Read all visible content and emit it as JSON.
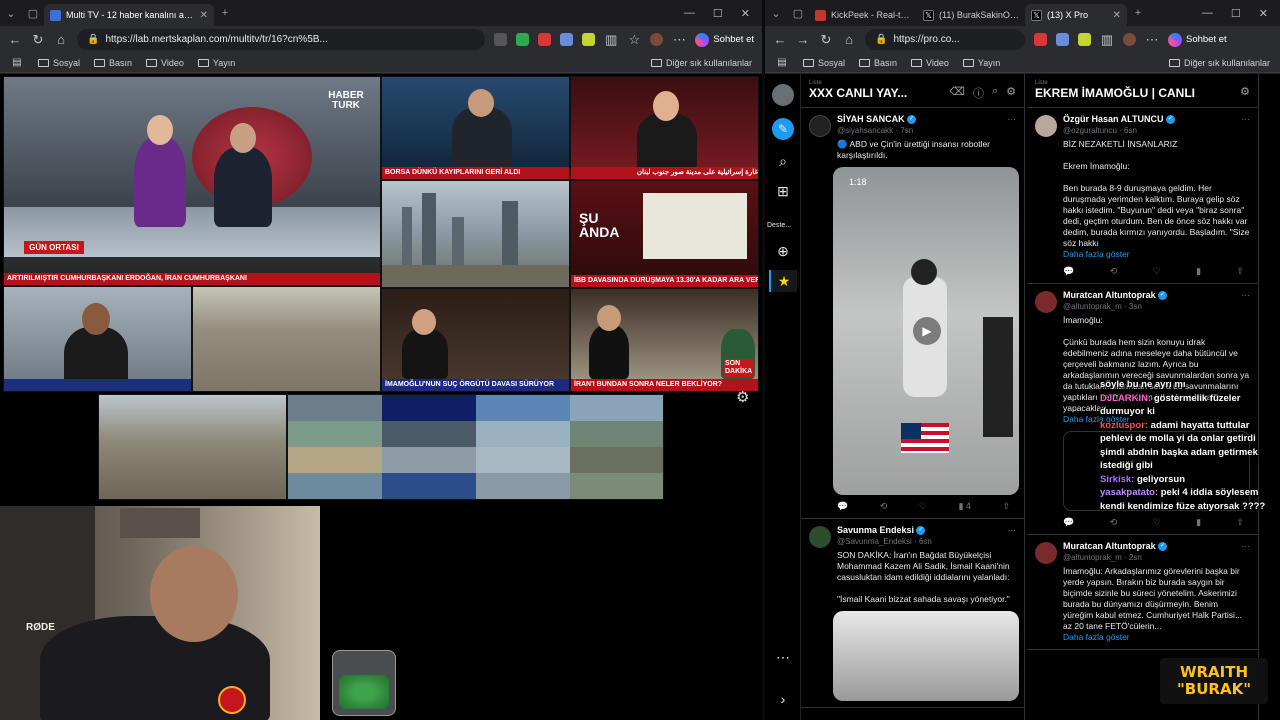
{
  "left_window": {
    "tabs": [
      {
        "title": "Multi TV - 12 haber kanalını aynı a..."
      }
    ],
    "url": "https://lab.mertskaplan.com/multitv/tr/16?cn%5B...",
    "chat_label": "Sohbet et",
    "bookmarks": [
      "Sosyal",
      "Basın",
      "Video",
      "Yayın"
    ],
    "bookmarks_right": "Diğer sık kullanılanlar"
  },
  "right_window": {
    "tabs": [
      {
        "title": "KickPeek - Real-tim..."
      },
      {
        "title": "(11) BurakSakinOl ..."
      },
      {
        "title": "(13) X Pro"
      }
    ],
    "url": "https://pro.co...",
    "chat_label": "Sohbet et",
    "bookmarks": [
      "Sosyal",
      "Basın",
      "Video",
      "Yayın"
    ],
    "bookmarks_right": "Diğer sık kullanılanlar"
  },
  "tv": {
    "t1_logo": "HABER TURK",
    "t1_badge": "GÜN ORTASI",
    "t1_ticker": "ARTIRILMIŞTIR     CUMHURBAŞKANI ERDOĞAN, İRAN CUMHURBAŞKANI",
    "t2_ticker": "BORSA DÜNKÜ KAYIPLARINI GERİ ALDI",
    "t3_ticker": "غارة إسرائيلية على مدينة صور جنوب لبنان",
    "t5_badge": "ŞU ANDA",
    "t5_ticker": "İBB DAVASINDA DURUŞMAYA 13.30'A KADAR ARA VERİLDİ",
    "t7_ticker": "İMAMOĞLU'NUN SUÇ ÖRGÜTÜ DAVASI SÜRÜYOR",
    "t8_ticker": "İRAN'I BUNDAN SONRA NELER BEKLİYOR?",
    "t8_badge": "SON DAKİKA",
    "mic_label": "RØDE"
  },
  "x_pro": {
    "col1_label": "Liste",
    "col1_title": "XXX CANLI YAY...",
    "col2_label": "Liste",
    "col2_title": "EKREM İMAMOĞLU | CANLI",
    "rail_deck": "Deste...",
    "col1_tweets": [
      {
        "name": "SİYAH SANCAK",
        "handle": "@siyahsancakk · 7sn",
        "body": "🔵 ABD ve Çin'in ürettiği insansı robotler karşılaştırıldı.",
        "media_label": "1:18",
        "likes": "4"
      },
      {
        "name": "Savunma Endeksi",
        "handle": "@Savunma_Endeksi · 6sn",
        "body": "SON DAKİKA: İran'ın Bağdat Büyükelçisi Mohammad Kazem Ali Sadik, İsmail Kaani'nin casusluktan idam edildiği iddialarını yalanladı:\n\n\"İsmail Kaani bizzat sahada savaşı yönetiyor.\""
      }
    ],
    "col2_tweets": [
      {
        "name": "Özgür Hasan ALTUNCU",
        "handle": "@ozguraltuncu · 6sn",
        "body": "BİZ NEZAKETLİ İNSANLARIZ\n\nEkrem İmamoğlu:\n\nBen burada 8-9 duruşmaya geldim. Her duruşmada yerimden kalktım. Buraya gelip söz hakkı istedim. \"Buyurun\" dedi veya \"biraz sonra\" dedi, geçtim oturdum. Ben de önce söz hakkı var dedim, burada kırmızı yanıyordu. Başladım. \"Size söz hakkı",
        "more": "Daha fazla göster"
      },
      {
        "name": "Muratcan Altuntoprak",
        "handle": "@altuntoprak_m · 3sn",
        "body": "İmamoğlu:\n\nÇünkü burada hem sizin konuyu idrak edebilmeniz adına meseleye daha bütüncül ve çerçeveli bakmanız lazım. Ayrıca bu arkadaşlarımın vereceği savunmalardan sonra ya da tutuklanmalarından sonra bu savunmalarını yaptıkları da iftiracı olan insanların burada yapacakları",
        "more": "Daha fazla göster"
      },
      {
        "name": "Muratcan Altuntoprak",
        "handle": "@altuntoprak_m · 2sn",
        "body": "İmamoğlu: Arkadaşlarımız görevlerini başka bir yerde yapsın. Bırakın biz burada saygın bir biçimde sizinle bu süreci yönetelim. Askerimizi burada bu dünyamızı düşürmeyin. Benim yüreğim kabul etmez. Cumhuriyet Halk Partisi... az 20 tane FETÖ'cülerin...",
        "more": "Daha fazla göster"
      }
    ]
  },
  "chat_overlay": [
    {
      "user": "",
      "text": "söyle bu ne ayrı mı"
    },
    {
      "user": "DJLARKIN:",
      "text": "göstermelik füzeler durmuyor ki"
    },
    {
      "user": "kozluspor:",
      "text": "adami hayatta tuttular pehlevi de molla yi da onlar getirdi şimdi abdnin başka adam getirmek istediği gibi"
    },
    {
      "user": "Sirkisk:",
      "text": "geliyorsun"
    },
    {
      "user": "yasakpatato:",
      "text": "peki 4 iddia söylesem kendi kendimize füze atıyorsak ????"
    }
  ],
  "streamer_badge": {
    "line1": "WRAITH",
    "line2": "\"BURAK\""
  }
}
